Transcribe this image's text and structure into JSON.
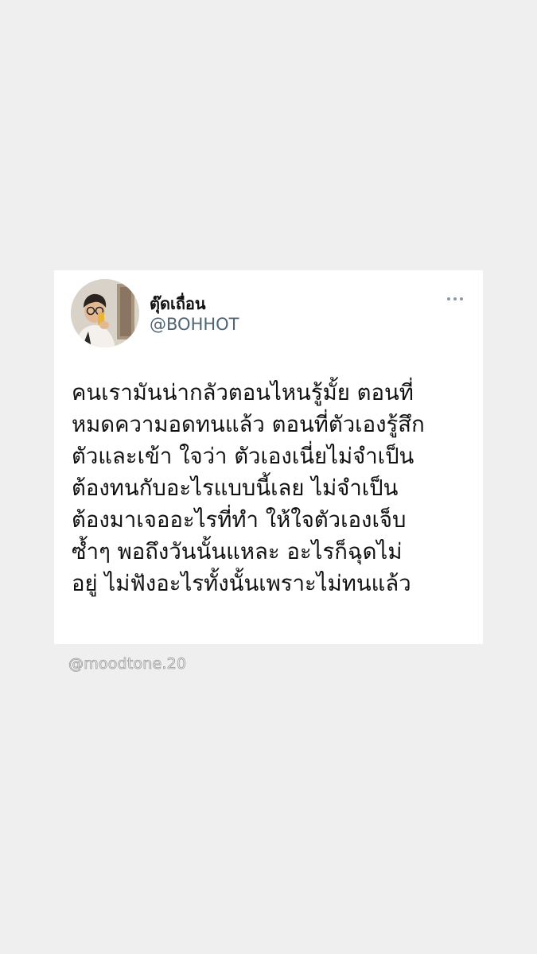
{
  "tweet": {
    "display_name": "ตุ๊ดเถื่อน",
    "handle": "@BOHHOT",
    "more_icon": "more-dots-icon",
    "lines": [
      "คนเรามันน่ากลัวตอนไหนรู้มั้ย ตอนที่",
      "หมดความอดทนแล้ว ตอนที่ตัวเองรู้สึก",
      "ตัวและเข้า ใจว่า ตัวเองเนี่ยไม่จำเป็น",
      "ต้องทนกับอะไรแบบนี้เลย ไม่จำเป็น",
      "ต้องมาเจออะไรที่ทำ ให้ใจตัวเองเจ็บ",
      "ซ้ำๆ พอถึงวันนั้นแหละ อะไรก็ฉุดไม่",
      "อยู่ ไม่ฟังอะไรทั้งนั้นเพราะไม่ทนแล้ว"
    ]
  },
  "watermark": "@moodtone.20",
  "colors": {
    "background": "#efefef",
    "card": "#ffffff",
    "text": "#111111",
    "handle": "#536471"
  }
}
